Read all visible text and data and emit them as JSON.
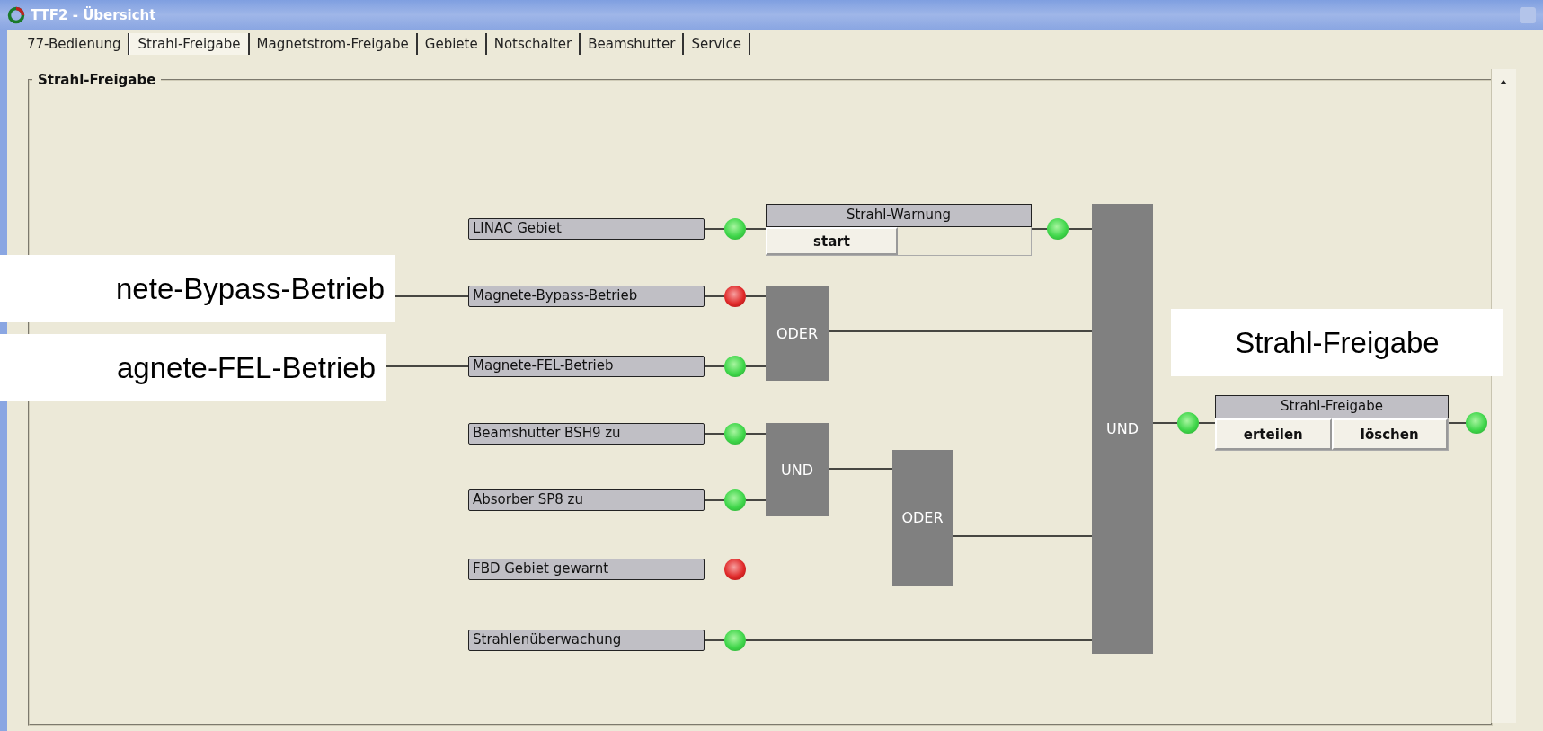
{
  "window": {
    "title": "TTF2 - Übersicht"
  },
  "tabs": [
    {
      "label": "77-Bedienung",
      "selected": false
    },
    {
      "label": "Strahl-Freigabe",
      "selected": true
    },
    {
      "label": "Magnetstrom-Freigabe",
      "selected": false
    },
    {
      "label": "Gebiete",
      "selected": false
    },
    {
      "label": "Notschalter",
      "selected": false
    },
    {
      "label": "Beamshutter",
      "selected": false
    },
    {
      "label": "Service",
      "selected": false
    }
  ],
  "group": {
    "title": "Strahl-Freigabe"
  },
  "inputs": [
    {
      "label": "LINAC Gebiet",
      "ok": true
    },
    {
      "label": "Magnete-Bypass-Betrieb",
      "ok": false
    },
    {
      "label": "Magnete-FEL-Betrieb",
      "ok": true
    },
    {
      "label": "Beamshutter BSH9 zu",
      "ok": true
    },
    {
      "label": "Absorber SP8 zu",
      "ok": true
    },
    {
      "label": "FBD Gebiet gewarnt",
      "ok": false
    },
    {
      "label": "Strahlenüberwachung",
      "ok": true
    }
  ],
  "warning": {
    "title": "Strahl-Warnung",
    "button": "start",
    "ok": true
  },
  "gates": [
    {
      "label": "ODER"
    },
    {
      "label": "UND"
    },
    {
      "label": "ODER"
    },
    {
      "label": "UND"
    }
  ],
  "output": {
    "input_ok": true,
    "title": "Strahl-Freigabe",
    "buttons": [
      "erteilen",
      "löschen"
    ],
    "ok": true
  },
  "callouts": [
    {
      "text": "nete-Bypass-Betrieb"
    },
    {
      "text": "agnete-FEL-Betrieb"
    },
    {
      "text": "Strahl-Freigabe"
    }
  ]
}
